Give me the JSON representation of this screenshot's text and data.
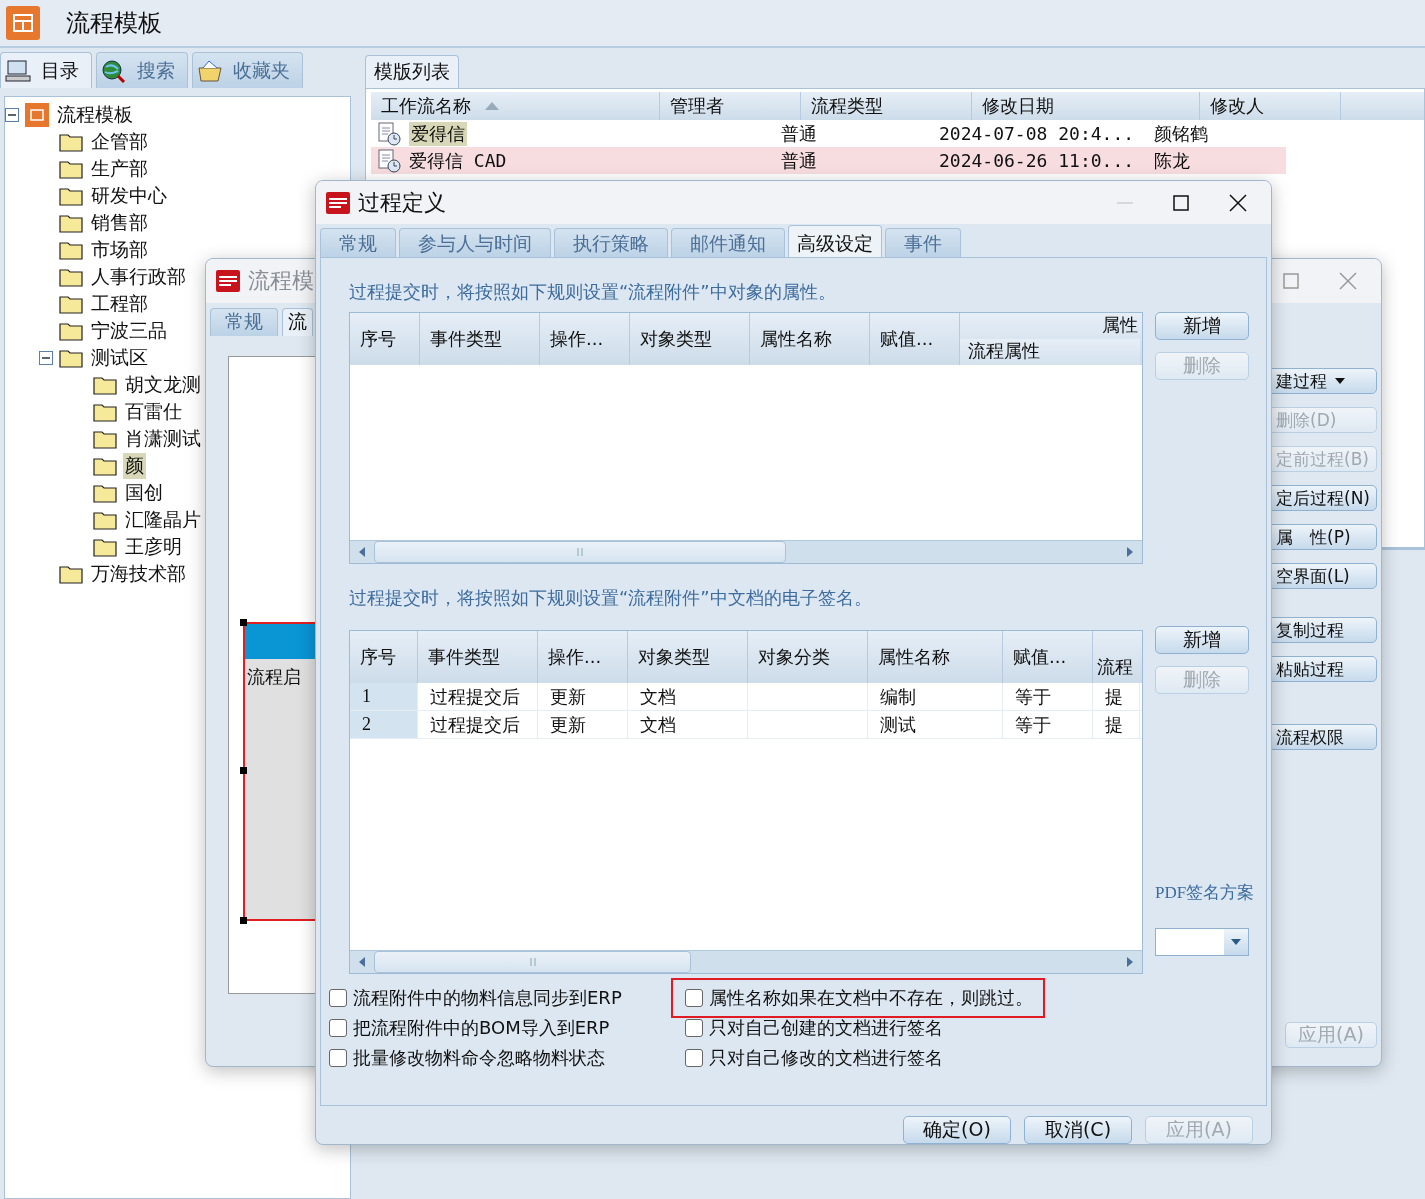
{
  "app": {
    "title": "流程模板"
  },
  "left_panel": {
    "tabs": [
      {
        "label": "目录",
        "selected": true,
        "kind": "computer"
      },
      {
        "label": "搜索",
        "selected": false,
        "kind": "search"
      },
      {
        "label": "收藏夹",
        "selected": false,
        "kind": "favorites"
      }
    ],
    "tree": [
      {
        "label": "流程模板",
        "kind": "root",
        "expanded": true,
        "selected": false,
        "children": [
          {
            "label": "企管部",
            "kind": "folder",
            "selected": false
          },
          {
            "label": "生产部",
            "kind": "folder",
            "selected": false
          },
          {
            "label": "研发中心",
            "kind": "folder",
            "selected": false
          },
          {
            "label": "销售部",
            "kind": "folder",
            "selected": false
          },
          {
            "label": "市场部",
            "kind": "folder",
            "selected": false
          },
          {
            "label": "人事行政部",
            "kind": "folder",
            "selected": false
          },
          {
            "label": "工程部",
            "kind": "folder",
            "selected": false
          },
          {
            "label": "宁波三品",
            "kind": "folder",
            "selected": false
          },
          {
            "label": "测试区",
            "kind": "folder",
            "expanded": true,
            "selected": false,
            "children": [
              {
                "label": "胡文龙测",
                "kind": "folder",
                "selected": false
              },
              {
                "label": "百雷仕",
                "kind": "folder",
                "selected": false
              },
              {
                "label": "肖潇测试",
                "kind": "folder",
                "selected": false
              },
              {
                "label": "颜",
                "kind": "folder",
                "selected": true
              },
              {
                "label": "国创",
                "kind": "folder",
                "selected": false
              },
              {
                "label": "汇隆晶片",
                "kind": "folder",
                "selected": false
              },
              {
                "label": "王彦明",
                "kind": "folder",
                "selected": false
              }
            ]
          },
          {
            "label": "万海技术部",
            "kind": "folder",
            "selected": false
          }
        ]
      }
    ]
  },
  "template_list": {
    "tab": "模版列表",
    "columns": [
      {
        "label": "工作流名称",
        "sorted": true
      },
      {
        "label": "管理者",
        "sorted": false
      },
      {
        "label": "流程类型",
        "sorted": false
      },
      {
        "label": "修改日期",
        "sorted": false
      },
      {
        "label": "修改人",
        "sorted": false
      }
    ],
    "rows": [
      {
        "cells": [
          "爱得信",
          "",
          "普通",
          "2024-07-08 20:4...",
          "颜铭鹤"
        ],
        "selected": false,
        "highlighted": true
      },
      {
        "cells": [
          "爱得信 CAD",
          "",
          "普通",
          "2024-06-26 11:0...",
          "陈龙"
        ],
        "selected": true,
        "highlighted": false
      }
    ]
  },
  "back_window": {
    "title": "流程模",
    "tabs": [
      {
        "label": "常规",
        "selected": false
      },
      {
        "label": "流",
        "selected": true
      }
    ],
    "node_label": "流程启",
    "button_groups": [
      [
        {
          "label": "建过程",
          "disabled": false,
          "caret": true
        },
        {
          "label": "删除(D)",
          "disabled": true
        },
        {
          "label": "定前过程(B)",
          "disabled": true
        },
        {
          "label": "定后过程(N)",
          "disabled": false
        },
        {
          "label": "属　性(P)",
          "disabled": false
        },
        {
          "label": "空界面(L)",
          "disabled": false
        }
      ],
      [
        {
          "label": "复制过程",
          "disabled": false
        },
        {
          "label": "粘贴过程",
          "disabled": false
        }
      ],
      [
        {
          "label": "流程权限",
          "disabled": false
        }
      ]
    ],
    "apply_button": {
      "label": "应用(A)",
      "disabled": true
    }
  },
  "dialog": {
    "title": "过程定义",
    "tabs": [
      {
        "label": "常规",
        "selected": false
      },
      {
        "label": "参与人与时间",
        "selected": false
      },
      {
        "label": "执行策略",
        "selected": false
      },
      {
        "label": "邮件通知",
        "selected": false
      },
      {
        "label": "高级设定",
        "selected": true
      },
      {
        "label": "事件",
        "selected": false
      }
    ],
    "property_rules": {
      "caption": "过程提交时，将按照如下规则设置“流程附件”中对象的属性。",
      "columns": [
        {
          "label": "序号"
        },
        {
          "label": "事件类型"
        },
        {
          "label": "操作..."
        },
        {
          "label": "对象类型"
        },
        {
          "label": "属性名称"
        },
        {
          "label": "赋值..."
        },
        {
          "label": "流程属性",
          "group": "属性"
        }
      ],
      "buttons": [
        {
          "label": "新增",
          "disabled": false
        },
        {
          "label": "删除",
          "disabled": true
        }
      ]
    },
    "signature_rules": {
      "caption": "过程提交时，将按照如下规则设置“流程附件”中文档的电子签名。",
      "columns": [
        {
          "label": "序号"
        },
        {
          "label": "事件类型"
        },
        {
          "label": "操作..."
        },
        {
          "label": "对象类型"
        },
        {
          "label": "对象分类"
        },
        {
          "label": "属性名称"
        },
        {
          "label": "赋值..."
        },
        {
          "label": "流程",
          "low": true
        }
      ],
      "rows": [
        [
          "1",
          "过程提交后",
          "更新",
          "文档",
          "",
          "编制",
          "等于",
          "提"
        ],
        [
          "2",
          "过程提交后",
          "更新",
          "文档",
          "",
          "测试",
          "等于",
          "提"
        ]
      ],
      "buttons": [
        {
          "label": "新增",
          "disabled": false
        },
        {
          "label": "删除",
          "disabled": true
        }
      ],
      "pdf_label": "PDF签名方案"
    },
    "options_left": [
      {
        "label": "流程附件中的物料信息同步到ERP",
        "checked": false,
        "highlighted": false
      },
      {
        "label": "把流程附件中的BOM导入到ERP",
        "checked": false,
        "highlighted": false
      },
      {
        "label": "批量修改物料命令忽略物料状态",
        "checked": false,
        "highlighted": false
      }
    ],
    "options_right": [
      {
        "label": "属性名称如果在文档中不存在，则跳过。",
        "checked": false,
        "highlighted": true
      },
      {
        "label": "只对自己创建的文档进行签名",
        "checked": false,
        "highlighted": false
      },
      {
        "label": "只对自己修改的文档进行签名",
        "checked": false,
        "highlighted": false
      }
    ],
    "footer_buttons": [
      {
        "label": "确定(O)",
        "disabled": false
      },
      {
        "label": "取消(C)",
        "disabled": false
      },
      {
        "label": "应用(A)",
        "disabled": true
      }
    ]
  }
}
